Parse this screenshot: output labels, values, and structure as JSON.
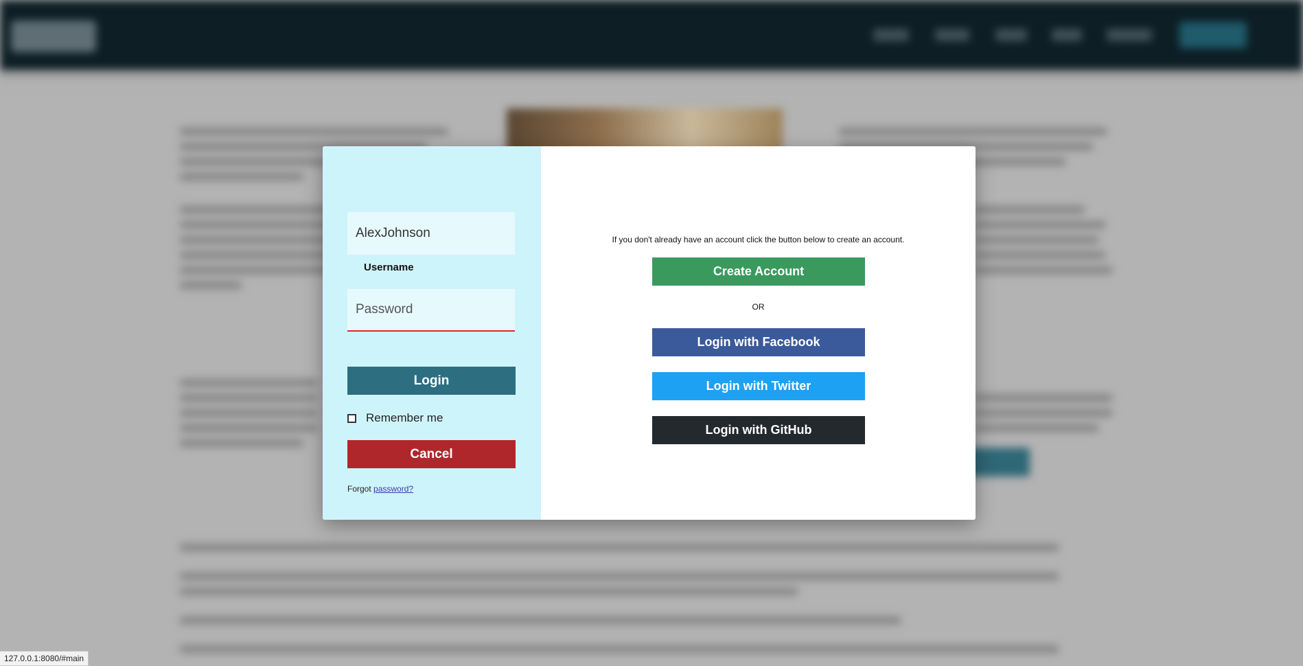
{
  "login_form": {
    "username_value": "AlexJohnson",
    "username_label": "Username",
    "password_placeholder": "Password",
    "login_button": "Login",
    "remember_label": "Remember me",
    "cancel_button": "Cancel",
    "forgot_prefix": "Forgot",
    "forgot_link": "password?"
  },
  "signup": {
    "prompt": "If you don't already have an account click the button below to create an account.",
    "create_button": "Create Account",
    "or_text": "OR",
    "facebook_button": "Login with Facebook",
    "twitter_button": "Login with Twitter",
    "github_button": "Login with GitHub"
  },
  "status_bar": {
    "url": "127.0.0.1:8080/#main"
  },
  "colors": {
    "left_pane": "#cef4fb",
    "login": "#2d6e80",
    "cancel": "#b0272b",
    "create": "#3a9a5e",
    "facebook": "#3b5a9b",
    "twitter": "#1ea1f2",
    "github": "#24292e",
    "header": "#0d1e25"
  }
}
